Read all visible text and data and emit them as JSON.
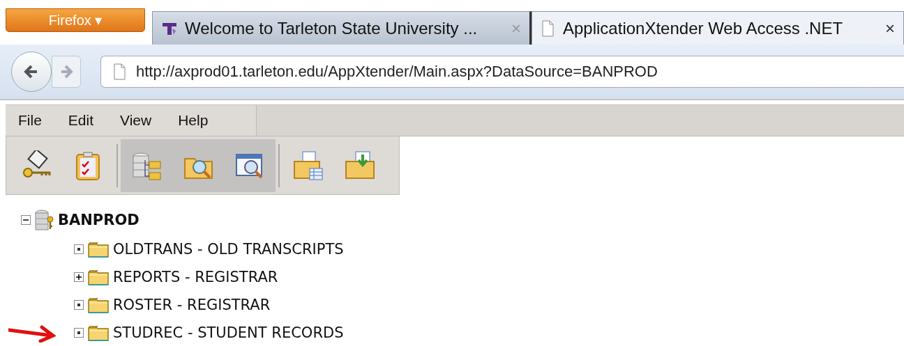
{
  "browser": {
    "menu_button": "Firefox ▾",
    "tabs": [
      {
        "label": "Welcome to Tarleton State University ...",
        "selected": false,
        "close": "×"
      },
      {
        "label": "ApplicationXtender Web Access .NET",
        "selected": true,
        "close": "×"
      }
    ],
    "url": "http://axprod01.tarleton.edu/AppXtender/Main.aspx?DataSource=BANPROD"
  },
  "menu": [
    "File",
    "Edit",
    "View",
    "Help"
  ],
  "toolbar": [
    [
      {
        "pressed": false
      },
      {
        "pressed": false
      }
    ],
    [
      {
        "pressed": true
      },
      {
        "pressed": true
      },
      {
        "pressed": true
      }
    ],
    [
      {
        "pressed": false
      },
      {
        "pressed": false
      }
    ]
  ],
  "tree": {
    "label": "BANPROD",
    "kind": "minus",
    "children": [
      {
        "label": "OLDTRANS - OLD TRANSCRIPTS",
        "kind": "dot"
      },
      {
        "label": "REPORTS - REGISTRAR",
        "kind": "plus"
      },
      {
        "label": "ROSTER - REGISTRAR",
        "kind": "dot"
      },
      {
        "label": "STUDREC - STUDENT RECORDS",
        "kind": "dot",
        "pointed_at": true
      }
    ]
  }
}
